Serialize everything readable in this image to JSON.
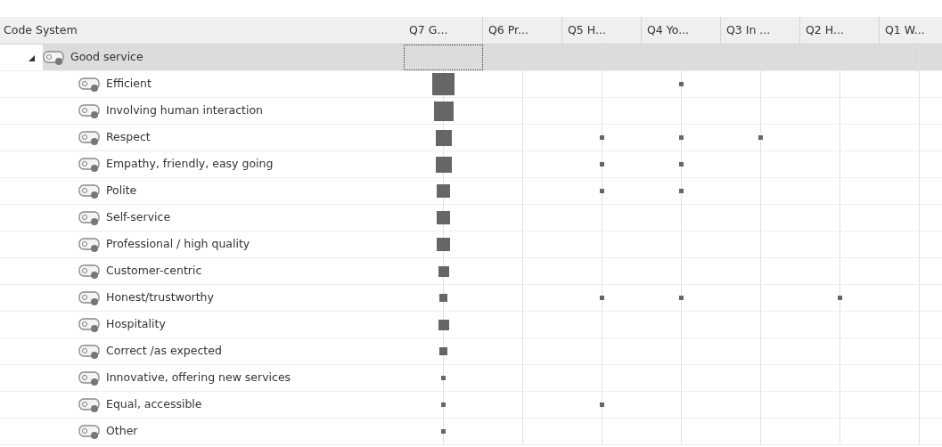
{
  "matrix": {
    "columns": [
      "Code System",
      "Q7 G...",
      "Q6 Pr...",
      "Q5 H...",
      "Q4 Yo...",
      "Q3 In ...",
      "Q2 H...",
      "Q1 W..."
    ],
    "rows": [
      {
        "label": "Good service",
        "expanded": true,
        "selected": true,
        "cells": [
          {
            "kind": "empty"
          },
          {
            "kind": "empty"
          },
          {
            "kind": "empty"
          },
          {
            "kind": "empty"
          },
          {
            "kind": "empty"
          },
          {
            "kind": "empty"
          },
          {
            "kind": "empty"
          }
        ],
        "children": [
          {
            "label": "Efficient",
            "selected": false,
            "cells": [
              {
                "kind": "xl"
              },
              {
                "kind": "empty"
              },
              {
                "kind": "empty"
              },
              {
                "kind": "dot"
              },
              {
                "kind": "empty"
              },
              {
                "kind": "empty"
              },
              {
                "kind": "empty"
              }
            ]
          },
          {
            "label": "Involving human interaction",
            "selected": false,
            "cells": [
              {
                "kind": "l"
              },
              {
                "kind": "empty"
              },
              {
                "kind": "empty"
              },
              {
                "kind": "empty"
              },
              {
                "kind": "empty"
              },
              {
                "kind": "empty"
              },
              {
                "kind": "empty"
              }
            ]
          },
          {
            "label": "Respect",
            "selected": false,
            "cells": [
              {
                "kind": "m"
              },
              {
                "kind": "empty"
              },
              {
                "kind": "dot"
              },
              {
                "kind": "dot"
              },
              {
                "kind": "dot"
              },
              {
                "kind": "empty"
              },
              {
                "kind": "empty"
              }
            ]
          },
          {
            "label": "Empathy, friendly, easy going",
            "selected": false,
            "cells": [
              {
                "kind": "m"
              },
              {
                "kind": "empty"
              },
              {
                "kind": "dot"
              },
              {
                "kind": "dot"
              },
              {
                "kind": "empty"
              },
              {
                "kind": "empty"
              },
              {
                "kind": "empty"
              }
            ]
          },
          {
            "label": "Polite",
            "selected": false,
            "cells": [
              {
                "kind": "ms"
              },
              {
                "kind": "empty"
              },
              {
                "kind": "dot"
              },
              {
                "kind": "dot"
              },
              {
                "kind": "empty"
              },
              {
                "kind": "empty"
              },
              {
                "kind": "empty"
              }
            ]
          },
          {
            "label": "Self-service",
            "selected": false,
            "cells": [
              {
                "kind": "ms"
              },
              {
                "kind": "empty"
              },
              {
                "kind": "empty"
              },
              {
                "kind": "empty"
              },
              {
                "kind": "empty"
              },
              {
                "kind": "empty"
              },
              {
                "kind": "empty"
              }
            ]
          },
          {
            "label": "Professional / high quality",
            "selected": false,
            "cells": [
              {
                "kind": "ms"
              },
              {
                "kind": "empty"
              },
              {
                "kind": "empty"
              },
              {
                "kind": "empty"
              },
              {
                "kind": "empty"
              },
              {
                "kind": "empty"
              },
              {
                "kind": "empty"
              }
            ]
          },
          {
            "label": "Customer-centric",
            "selected": false,
            "cells": [
              {
                "kind": "s"
              },
              {
                "kind": "empty"
              },
              {
                "kind": "empty"
              },
              {
                "kind": "empty"
              },
              {
                "kind": "empty"
              },
              {
                "kind": "empty"
              },
              {
                "kind": "empty"
              }
            ]
          },
          {
            "label": "Honest/trustworthy",
            "selected": false,
            "cells": [
              {
                "kind": "xs"
              },
              {
                "kind": "empty"
              },
              {
                "kind": "dot"
              },
              {
                "kind": "dot"
              },
              {
                "kind": "empty"
              },
              {
                "kind": "dot"
              },
              {
                "kind": "empty"
              }
            ]
          },
          {
            "label": "Hospitality",
            "selected": false,
            "cells": [
              {
                "kind": "s"
              },
              {
                "kind": "empty"
              },
              {
                "kind": "empty"
              },
              {
                "kind": "empty"
              },
              {
                "kind": "empty"
              },
              {
                "kind": "empty"
              },
              {
                "kind": "empty"
              }
            ]
          },
          {
            "label": "Correct /as expected",
            "selected": false,
            "cells": [
              {
                "kind": "xs"
              },
              {
                "kind": "empty"
              },
              {
                "kind": "empty"
              },
              {
                "kind": "empty"
              },
              {
                "kind": "empty"
              },
              {
                "kind": "empty"
              },
              {
                "kind": "empty"
              }
            ]
          },
          {
            "label": "Innovative, offering new services",
            "selected": false,
            "cells": [
              {
                "kind": "dot"
              },
              {
                "kind": "empty"
              },
              {
                "kind": "empty"
              },
              {
                "kind": "empty"
              },
              {
                "kind": "empty"
              },
              {
                "kind": "empty"
              },
              {
                "kind": "empty"
              }
            ]
          },
          {
            "label": "Equal, accessible",
            "selected": false,
            "cells": [
              {
                "kind": "dot"
              },
              {
                "kind": "empty"
              },
              {
                "kind": "dot"
              },
              {
                "kind": "empty"
              },
              {
                "kind": "empty"
              },
              {
                "kind": "empty"
              },
              {
                "kind": "empty"
              }
            ]
          },
          {
            "label": "Other",
            "selected": false,
            "cells": [
              {
                "kind": "dot"
              },
              {
                "kind": "empty"
              },
              {
                "kind": "empty"
              },
              {
                "kind": "empty"
              },
              {
                "kind": "empty"
              },
              {
                "kind": "empty"
              },
              {
                "kind": "empty"
              }
            ]
          }
        ]
      }
    ]
  }
}
